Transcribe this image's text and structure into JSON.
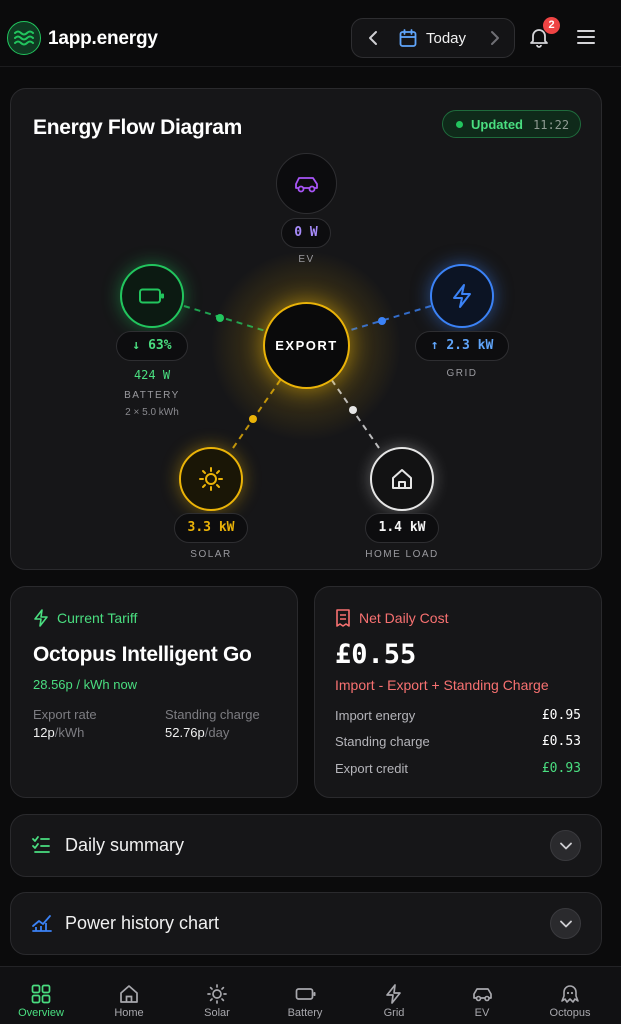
{
  "header": {
    "brand": "1app.energy",
    "date_label": "Today",
    "notification_count": "2"
  },
  "flow": {
    "title": "Energy Flow Diagram",
    "updated_label": "Updated",
    "updated_time": "11:22",
    "center_label": "EXPORT",
    "ev": {
      "value": "0 W",
      "caption": "EV"
    },
    "battery": {
      "pill": "63%",
      "power": "424 W",
      "caption": "BATTERY",
      "sub": "2 × 5.0 kWh"
    },
    "grid": {
      "pill": "2.3 kW",
      "caption": "GRID"
    },
    "solar": {
      "pill": "3.3 kW",
      "caption": "SOLAR"
    },
    "home": {
      "pill": "1.4 kW",
      "caption": "HOME LOAD"
    }
  },
  "tariff": {
    "heading": "Current Tariff",
    "name": "Octopus Intelligent Go",
    "rate_now": "28.56p / kWh now",
    "export_label": "Export rate",
    "export_value": "12p",
    "export_unit": "/kWh",
    "standing_label": "Standing charge",
    "standing_value": "52.76p",
    "standing_unit": "/day"
  },
  "cost": {
    "heading": "Net Daily Cost",
    "total": "£0.55",
    "formula": "Import - Export + Standing Charge",
    "rows": [
      {
        "label": "Import energy",
        "value": "£0.95"
      },
      {
        "label": "Standing charge",
        "value": "£0.53"
      },
      {
        "label": "Export credit",
        "value": "£0.93"
      }
    ]
  },
  "accordions": {
    "daily_summary": "Daily summary",
    "power_history": "Power history chart"
  },
  "nav": {
    "overview": "Overview",
    "home": "Home",
    "solar": "Solar",
    "battery": "Battery",
    "grid": "Grid",
    "ev": "EV",
    "octopus": "Octopus"
  },
  "colors": {
    "accent_green": "#22c55e",
    "export_gold": "#eab308",
    "grid_blue": "#3b82f6",
    "ev_purple": "#a855f7",
    "cost_red": "#f87171"
  }
}
